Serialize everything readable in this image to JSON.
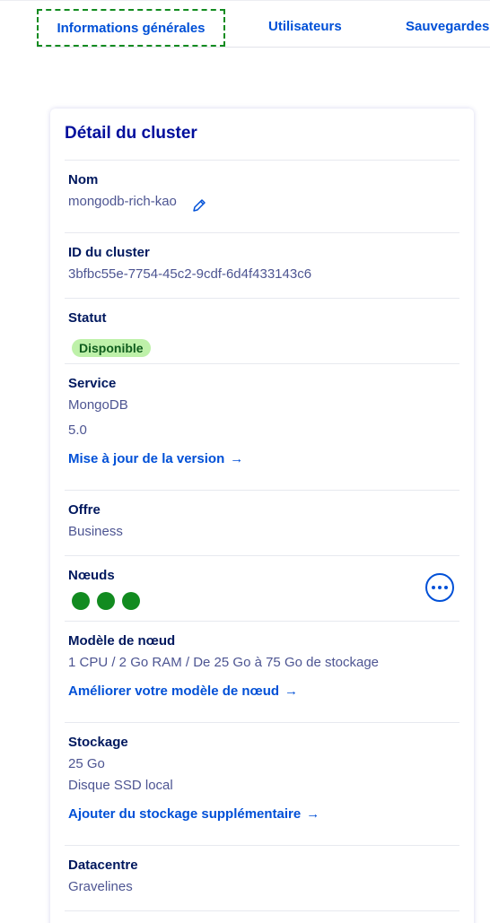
{
  "tabs": [
    {
      "label": "Informations générales",
      "active": true
    },
    {
      "label": "Utilisateurs",
      "active": false
    },
    {
      "label": "Sauvegardes",
      "active": false
    }
  ],
  "card": {
    "title": "Détail du cluster",
    "name": {
      "label": "Nom",
      "value": "mongodb-rich-kao"
    },
    "cluster_id": {
      "label": "ID du cluster",
      "value": "3bfbc55e-7754-45c2-9cdf-6d4f433143c6"
    },
    "status": {
      "label": "Statut",
      "value": "Disponible"
    },
    "service": {
      "label": "Service",
      "engine": "MongoDB",
      "version": "5.0",
      "link": "Mise à jour de la version"
    },
    "plan": {
      "label": "Offre",
      "value": "Business"
    },
    "nodes": {
      "label": "Nœuds",
      "count": 3
    },
    "node_model": {
      "label": "Modèle de nœud",
      "value": "1 CPU / 2 Go RAM / De 25 Go à 75 Go de stockage",
      "link": "Améliorer votre modèle de nœud"
    },
    "storage": {
      "label": "Stockage",
      "size": "25 Go",
      "type": "Disque SSD local",
      "link": "Ajouter du stockage supplémentaire"
    },
    "datacenter": {
      "label": "Datacentre",
      "value": "Gravelines"
    }
  },
  "colors": {
    "accent": "#0050d7",
    "success": "#128b20",
    "badge_bg": "#bef1a9",
    "heading": "#000e9c"
  }
}
